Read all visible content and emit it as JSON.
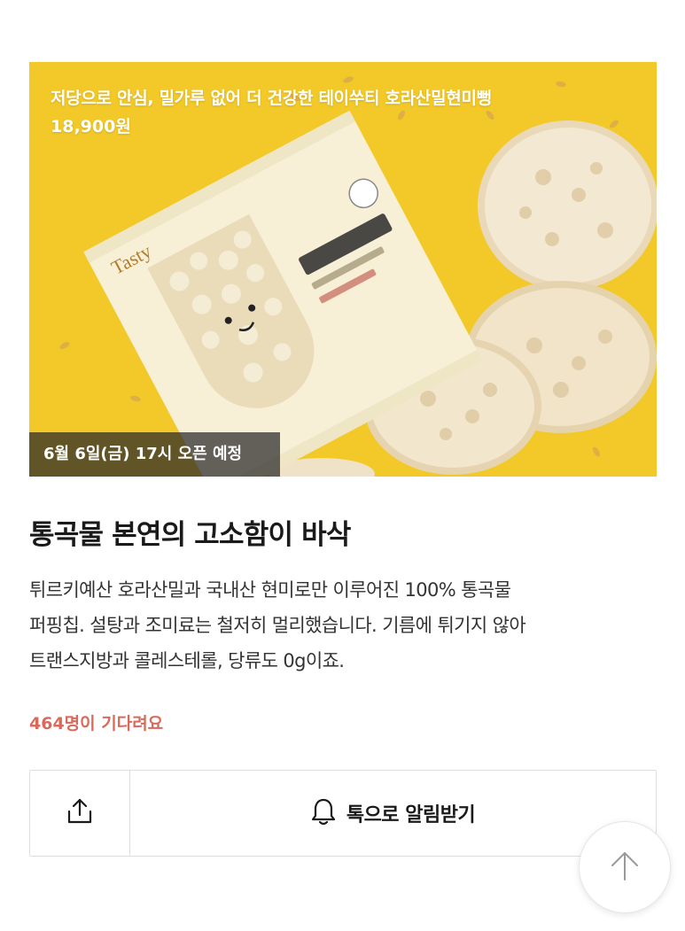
{
  "hero": {
    "title": "저당으로 안심, 밀가루 없어 더 건강한 테이쑤티 호라산밀현미뻥",
    "price": "18,900원",
    "open_notice": "6월 6일(금) 17시 오픈 예정",
    "background_color": "#f2c928"
  },
  "product": {
    "headline": "통곡물 본연의 고소함이 바삭",
    "description_lines": [
      "튀르키예산 호라산밀과 국내산 현미로만 이루어진 100% 통곡물",
      "퍼핑칩. 설탕과 조미료는 철저히 멀리했습니다. 기름에 튀기지 않아",
      "트랜스지방과 콜레스테롤, 당류도 0g이죠."
    ],
    "waiting_count": "464명이 기다려요",
    "waiting_color": "#d96a5b"
  },
  "actions": {
    "share_icon": "share-icon",
    "notify_icon": "bell-icon",
    "notify_label": "톡으로 알림받기",
    "scroll_top_icon": "arrow-up-icon"
  }
}
